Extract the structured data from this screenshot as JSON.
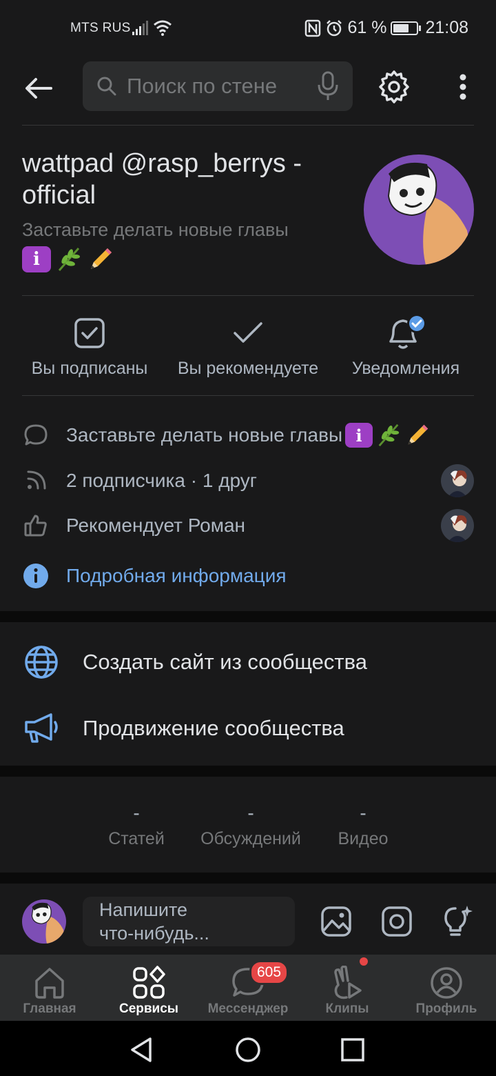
{
  "status_bar": {
    "carrier": "MTS RUS",
    "battery": "61 %",
    "time": "21:08"
  },
  "search": {
    "placeholder": "Поиск по стене"
  },
  "group": {
    "name": "wattpad @rasp_berrys - official",
    "status": "Заставьте делать новые главы"
  },
  "actions": [
    {
      "label": "Вы подписаны"
    },
    {
      "label": "Вы рекомендуете"
    },
    {
      "label": "Уведомления"
    }
  ],
  "info": {
    "status_text": "Заставьте делать новые главы",
    "followers": "2 подписчика · 1 друг",
    "recommends": "Рекомендует Роман",
    "details_link": "Подробная информация"
  },
  "menu": {
    "create_site": "Создать сайт из сообщества",
    "promotion": "Продвижение сообщества"
  },
  "counters": [
    {
      "value": "-",
      "label": "Статей"
    },
    {
      "value": "-",
      "label": "Обсуждений"
    },
    {
      "value": "-",
      "label": "Видео"
    }
  ],
  "composer": {
    "line1": "Напишите",
    "line2": "что-нибудь..."
  },
  "tabs": [
    {
      "label": "Главная"
    },
    {
      "label": "Сервисы"
    },
    {
      "label": "Мессенджер",
      "badge": "605"
    },
    {
      "label": "Клипы"
    },
    {
      "label": "Профиль"
    }
  ],
  "colors": {
    "background": "#19191a",
    "accent": "#71aaeb",
    "badge": "#e64646",
    "avatar_bg": "#7d4eb5"
  }
}
